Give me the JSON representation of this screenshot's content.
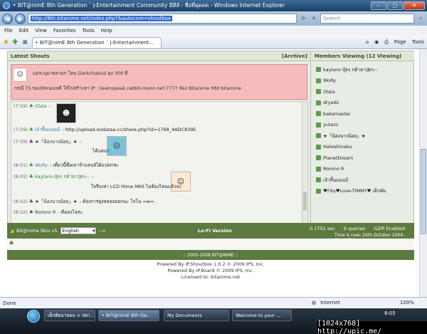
{
  "window": {
    "title": "• BIT@nimE 8th Generation ` J-Entertainment Community มีดีส์ - ชื่อ่ที่สุดดด - Windows Internet Explorer",
    "min": "–",
    "max": "□",
    "close": "✕"
  },
  "address": {
    "url": "http://8th.bitanime.net/index.php?&autocom=shoutbox",
    "search_placeholder": "Search"
  },
  "menu": [
    "File",
    "Edit",
    "View",
    "Favorites",
    "Tools",
    "Help"
  ],
  "tab": {
    "label": "• BIT@nimE 8th Generation ` J-Entertainment..."
  },
  "toolbar": {
    "page": "Page",
    "tools": "Tools"
  },
  "shoutbox": {
    "title": "Latest Shouts",
    "archive": "[Archive]",
    "announce_line1": "แม่ระบุมาตลามก โดน Darkchabuti ยุ่ง 300 ที",
    "announce_line2": "กรณี TS ของบิทเนเถลดี ให้ไปสร้างหา IP : teamspeak.rabbit-moon.net:7777 ห้อง Bitanime รหัส bitanime",
    "shouts": [
      {
        "time": "(7:59)",
        "user": "Olala",
        "text": "-"
      },
      {
        "time": "(7:59)",
        "user": "เจ้าสิ้นแมนป์",
        "text": "- http://upload.sodazaa.cc/share.php?id=1768_4ADC839E"
      },
      {
        "time": "(7:59)",
        "user": "★「น้องนางน้อย」★",
        "text": "-"
      },
      {
        "time": "",
        "user": "",
        "text": "ได้แตมา"
      },
      {
        "time": "(8:01)",
        "user": "WoRy",
        "text": "- เดี๋ยวนี้ซื่อเทาจ้าแสนล์ได้แปลกชะ"
      },
      {
        "time": "(8:01)",
        "user": "kaytaro-ปุ๋ยๆ กด้ายาปุ่ยๆ~",
        "text": "-"
      },
      {
        "time": "",
        "user": "",
        "text": "ใจรีบเท่า LCD Hime MKII ไม่ต้องไหนแล้วละ"
      },
      {
        "time": "(8:02)",
        "user": "★「น้องนางน้อย」★",
        "text": "- ต้องการยุ่งหลออยอกนะ โจโน =w=."
      },
      {
        "time": "(8:02)",
        "user": "Rorono R",
        "text": "- คือลงโจห่ะ"
      }
    ]
  },
  "members": {
    "title": "Members Viewing (12 Viewing)",
    "list": [
      "kaytaro-ปุ๋ยๆ กด้ายาปุ่ยๆ~",
      "WoRy",
      "Olala",
      "dryadz",
      "bakamaster",
      "yutaro",
      "★「น้องนางน้อย」★",
      "Hateshinaku",
      "PlanetDream",
      "Rorono R",
      "เจ้าสิ้นแมนป์",
      "♥Fάγ♥Love-TIMMY♥ เด็กตัม"
    ]
  },
  "bottom": {
    "skin_label": "Bit@nime Skin v5",
    "language": "English",
    "arrow": "-->",
    "lofi": "Lo-Fi Version",
    "exec_time": "0.1752 sec",
    "queries": "9 queries",
    "gzip": "GZIP Enabled",
    "time_now": "Time is now: 25th October 2009 - 08:01 PM"
  },
  "copyright_bar": ":: 2005-2008 BIT@NIME ::",
  "footer": {
    "line1": "Powered By IP.Shoutbox 1.0.2 © 2009 IPS, Inc.",
    "line2": "Powered By IP.Board © 2009 IPS, Inc.",
    "line3": "Licensed to: bitanime.net"
  },
  "status": {
    "text": "Done",
    "zone": "Internet",
    "zoom": "100%"
  },
  "taskbar": {
    "items": [
      "เด็กติดอาหอม > Wri...",
      "• BIT@nimE 8th Ge...",
      "My Documents",
      "Welcome to your ..."
    ],
    "clock": "8:05"
  },
  "watermark": "[1024x768] http://upic.me/"
}
